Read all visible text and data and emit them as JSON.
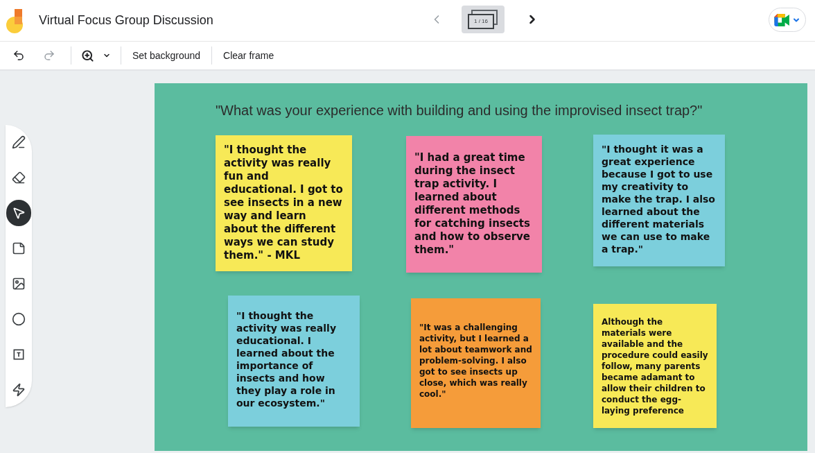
{
  "window": {
    "title": "Virtual Focus Group Discussion"
  },
  "frame_nav": {
    "prev_disabled": true,
    "counter": "1 / 16",
    "next_disabled": false
  },
  "toolbar": [
    {
      "kind": "undo",
      "disabled": false
    },
    {
      "kind": "redo",
      "disabled": true
    },
    {
      "kind": "zoom",
      "disabled": false
    },
    {
      "kind": "text",
      "label": "Set background",
      "disabled": false
    },
    {
      "kind": "text",
      "label": "Clear frame",
      "disabled": false
    }
  ],
  "tools": [
    {
      "kind": "pen",
      "selected": false
    },
    {
      "kind": "eraser",
      "selected": false
    },
    {
      "kind": "select",
      "selected": true
    },
    {
      "kind": "sticky-note",
      "selected": false
    },
    {
      "kind": "image",
      "selected": false
    },
    {
      "kind": "circle",
      "selected": false
    },
    {
      "kind": "text-box",
      "selected": false
    },
    {
      "kind": "laser",
      "selected": false
    }
  ],
  "frame": {
    "title": "\"What was your experience with building and using the improvised insect trap?\"",
    "notes": [
      {
        "color": "#f7e957",
        "text": "\"I thought the activity was really fun and educational. I got to see insects in a new way and learn about the different ways we can study them.\" - MKL"
      },
      {
        "color": "#f283a9",
        "text": "\"I had a great time during the insect trap activity. I learned about different methods for catching insects and how to observe them.\""
      },
      {
        "color": "#7ccfdc",
        "text": "\"I thought it was a great experience because I got to use my creativity to make the trap. I also learned about the different materials we can use to make a trap.\""
      },
      {
        "color": "#7ccfdc",
        "text": "\"I thought the activity was really educational. I learned about the importance of insects and how they play a role in our ecosystem.\""
      },
      {
        "color": "#f59c3a",
        "text": "\"It was a challenging activity, but I learned a lot about teamwork and problem-solving. I also got to see insects up close, which was really cool.\""
      },
      {
        "color": "#f7e957",
        "text": "Although the materials were available and the procedure could easily follow, many parents became adamant to allow their children to conduct the egg-laying preference"
      }
    ]
  }
}
